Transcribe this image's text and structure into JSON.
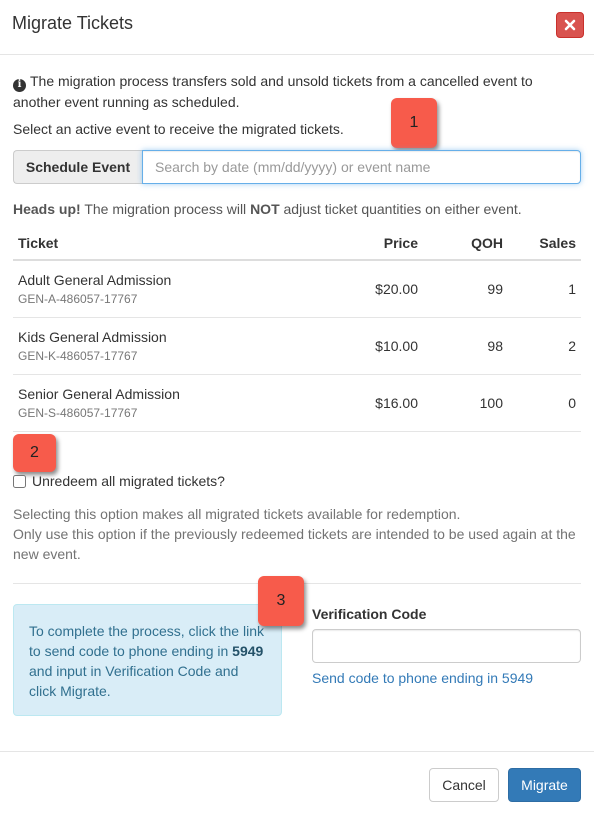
{
  "header": {
    "title": "Migrate Tickets",
    "close_icon": "close-icon"
  },
  "info": {
    "icon": "info-circle-icon",
    "text": "The migration process transfers sold and unsold tickets from a cancelled event to another event running as scheduled."
  },
  "select_instruction": "Select an active event to receive the migrated tickets.",
  "schedule_event": {
    "addon_label": "Schedule Event",
    "placeholder": "Search by date (mm/dd/yyyy) or event name",
    "value": ""
  },
  "heads_up": {
    "bold_prefix": "Heads up!",
    "text_before": " The migration process will ",
    "emphasis": "NOT",
    "text_after": " adjust ticket quantities on either event."
  },
  "table": {
    "headers": {
      "ticket": "Ticket",
      "price": "Price",
      "qoh": "QOH",
      "sales": "Sales"
    },
    "rows": [
      {
        "name": "Adult General Admission",
        "code": "GEN-A-486057-17767",
        "price": "$20.00",
        "qoh": "99",
        "sales": "1"
      },
      {
        "name": "Kids General Admission",
        "code": "GEN-K-486057-17767",
        "price": "$10.00",
        "qoh": "98",
        "sales": "2"
      },
      {
        "name": "Senior General Admission",
        "code": "GEN-S-486057-17767",
        "price": "$16.00",
        "qoh": "100",
        "sales": "0"
      }
    ]
  },
  "callouts": [
    "1",
    "2",
    "3"
  ],
  "unredeem": {
    "label": "Unredeem all migrated tickets?",
    "checked": false,
    "help_line1": "Selecting this option makes all migrated tickets available for redemption.",
    "help_line2": "Only use this option if the previously redeemed tickets are intended to be used again at the new event."
  },
  "alert": {
    "text_before": "To complete the process, click the link to send code to phone ending in ",
    "phone_suffix": "5949",
    "text_after": " and input in Verification Code and click Migrate."
  },
  "verification": {
    "label": "Verification Code",
    "value": "",
    "send_link": "Send code to phone ending in 5949"
  },
  "footer": {
    "cancel_label": "Cancel",
    "migrate_label": "Migrate"
  },
  "colors": {
    "primary": "#337ab7",
    "danger": "#d9534f",
    "callout": "#f75b4b",
    "alert_bg": "#d9edf7",
    "alert_text": "#31708f"
  }
}
